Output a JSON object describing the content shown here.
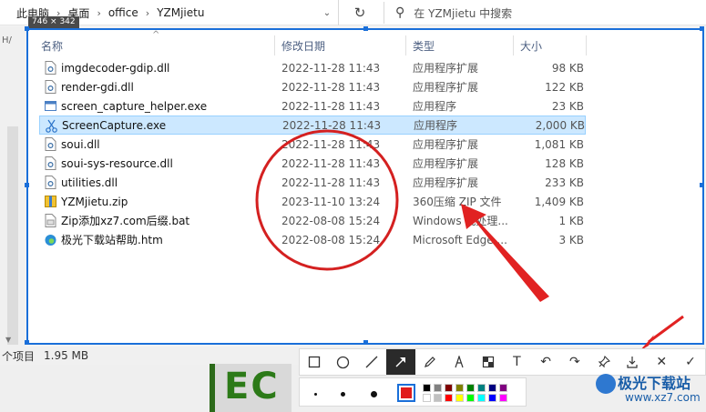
{
  "address": {
    "crumbs": [
      "此电脑",
      "桌面",
      "office",
      "YZMjietu"
    ],
    "search_placeholder": "在 YZMjietu 中搜索"
  },
  "left_strip": {
    "label": "H/"
  },
  "capture": {
    "size_label": "746 × 342",
    "columns": {
      "name": "名称",
      "date": "修改日期",
      "type": "类型",
      "size": "大小"
    },
    "files": [
      {
        "name": "imgdecoder-gdip.dll",
        "date": "2022-11-28 11:43",
        "type": "应用程序扩展",
        "size": "98 KB",
        "icon": "dll-file-icon"
      },
      {
        "name": "render-gdi.dll",
        "date": "2022-11-28 11:43",
        "type": "应用程序扩展",
        "size": "122 KB",
        "icon": "dll-file-icon"
      },
      {
        "name": "screen_capture_helper.exe",
        "date": "2022-11-28 11:43",
        "type": "应用程序",
        "size": "23 KB",
        "icon": "exe-window-icon"
      },
      {
        "name": "ScreenCapture.exe",
        "date": "2022-11-28 11:43",
        "type": "应用程序",
        "size": "2,000 KB",
        "icon": "scissors-icon",
        "selected": true
      },
      {
        "name": "soui.dll",
        "date": "2022-11-28 11:43",
        "type": "应用程序扩展",
        "size": "1,081 KB",
        "icon": "dll-file-icon"
      },
      {
        "name": "soui-sys-resource.dll",
        "date": "2022-11-28 11:43",
        "type": "应用程序扩展",
        "size": "128 KB",
        "icon": "dll-file-icon"
      },
      {
        "name": "utilities.dll",
        "date": "2022-11-28 11:43",
        "type": "应用程序扩展",
        "size": "233 KB",
        "icon": "dll-file-icon"
      },
      {
        "name": "YZMjietu.zip",
        "date": "2023-11-10 13:24",
        "type": "360压缩 ZIP 文件",
        "size": "1,409 KB",
        "icon": "zip-archive-icon"
      },
      {
        "name": "Zip添加xz7.com后缀.bat",
        "date": "2022-08-08 15:24",
        "type": "Windows 批处理...",
        "size": "1 KB",
        "icon": "bat-file-icon"
      },
      {
        "name": "极光下载站帮助.htm",
        "date": "2022-08-08 15:24",
        "type": "Microsoft Edge ...",
        "size": "3 KB",
        "icon": "edge-browser-icon"
      }
    ]
  },
  "status": {
    "items": "个项目",
    "size": "1.95 MB"
  },
  "bg_logo_text": "EC",
  "toolbar": {
    "tools": [
      "rectangle-icon",
      "ellipse-icon",
      "line-icon",
      "arrow-icon",
      "pencil-icon",
      "marker-icon",
      "mosaic-icon",
      "text-icon",
      "undo-icon",
      "redo-icon",
      "pin-icon",
      "save-icon",
      "cancel-icon",
      "confirm-icon"
    ],
    "active_tool": "arrow-icon",
    "selected_color": "#e11c1c",
    "palette": [
      "#000000",
      "#808080",
      "#800000",
      "#808000",
      "#008000",
      "#008080",
      "#000080",
      "#800080",
      "#ffffff",
      "#c0c0c0",
      "#ff0000",
      "#ffff00",
      "#00ff00",
      "#00ffff",
      "#0000ff",
      "#ff00ff"
    ]
  },
  "watermark": {
    "title": "极光下载站",
    "url": "www.xz7.com"
  },
  "colors": {
    "annotation_red": "#e11c1c",
    "selection_blue": "#1a6fd9"
  }
}
